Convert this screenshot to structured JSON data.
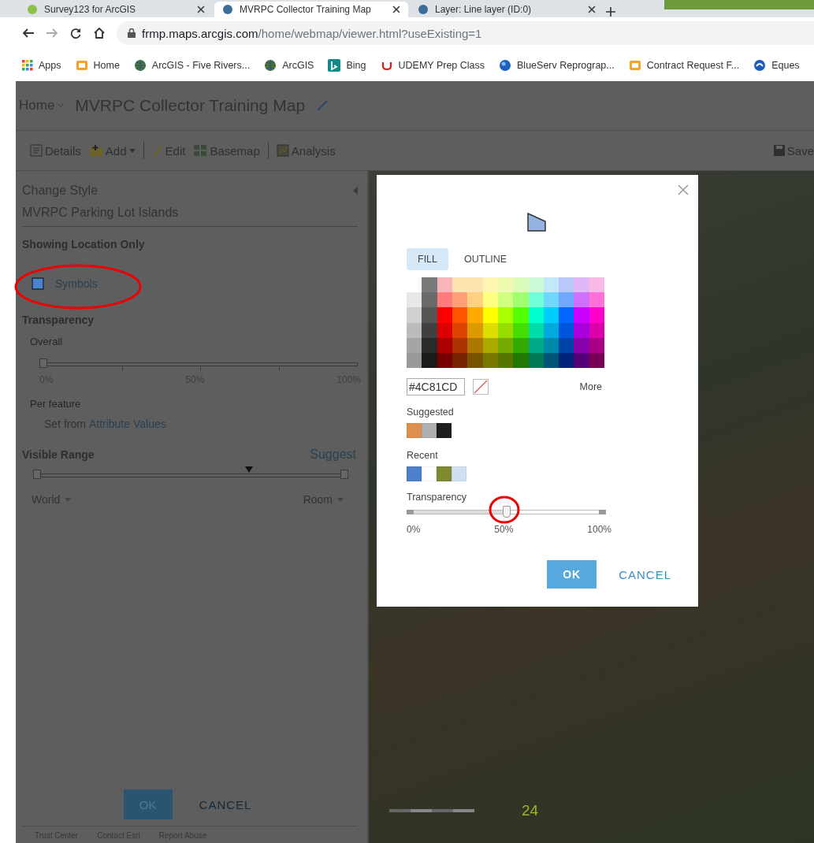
{
  "browser": {
    "tabs": [
      {
        "title": "Survey123 for ArcGIS",
        "selected": false
      },
      {
        "title": "MVRPC Collector Training Map",
        "selected": true
      },
      {
        "title": "Layer: Line layer (ID:0)",
        "selected": false
      }
    ],
    "address": {
      "host": "frmp.maps.arcgis.com",
      "path": "/home/webmap/viewer.html?useExisting=1"
    },
    "bookmarks": [
      {
        "label": "Apps",
        "kind": "apps"
      },
      {
        "label": "Home",
        "kind": "folder"
      },
      {
        "label": "ArcGIS - Five Rivers...",
        "kind": "globe"
      },
      {
        "label": "ArcGIS",
        "kind": "globe"
      },
      {
        "label": "Bing",
        "kind": "bing"
      },
      {
        "label": "UDEMY Prep Class",
        "kind": "udemy"
      },
      {
        "label": "BlueServ Reprograp...",
        "kind": "sphere"
      },
      {
        "label": "Contract Request F...",
        "kind": "folder"
      },
      {
        "label": "Eques",
        "kind": "edge"
      }
    ]
  },
  "header": {
    "home": "Home",
    "title": "MVRPC Collector Training Map"
  },
  "toolbar": {
    "items": [
      {
        "label": "Details",
        "kind": "details"
      },
      {
        "label": "Add",
        "kind": "add"
      },
      {
        "kind": "separator"
      },
      {
        "label": "Edit",
        "kind": "edit"
      },
      {
        "label": "Basemap",
        "kind": "basemap"
      },
      {
        "kind": "separator"
      },
      {
        "label": "Analysis",
        "kind": "analysis"
      }
    ],
    "save": "Save"
  },
  "panel": {
    "heading": "Change Style",
    "layer": "MVRPC Parking Lot Islands",
    "section": "Showing Location Only",
    "symbols": "Symbols",
    "transparency": {
      "title": "Transparency",
      "overall": "Overall",
      "level": 0,
      "ticks": [
        "0%",
        "50%",
        "100%"
      ],
      "per_feature": "Per feature",
      "set_from": "Set from",
      "link": "Attribute Values"
    },
    "visible_range": {
      "title": "Visible Range",
      "suggest": "Suggest",
      "level": 0.69,
      "min": "World",
      "max": "Room"
    },
    "ok": "OK",
    "cancel": "CANCEL",
    "footer": [
      "Trust Center",
      "Contact Esri",
      "Report Abuse"
    ]
  },
  "map": {
    "scale_label": "24"
  },
  "dialog": {
    "tabs": [
      {
        "label": "FILL",
        "selected": true
      },
      {
        "label": "OUTLINE",
        "selected": false
      }
    ],
    "palette": [
      [
        {
          "color": "#7a7a7a"
        },
        {
          "color": "#f8b4b8"
        },
        {
          "color": "#fde3b0"
        },
        {
          "color": "#fde3b0"
        },
        {
          "color": "#fdf5b0"
        },
        {
          "color": "#eefab0"
        },
        {
          "color": "#dcfab8"
        },
        {
          "color": "#c8fad8"
        },
        {
          "color": "#c0e8f8"
        },
        {
          "color": "#b8c8f8"
        },
        {
          "color": "#e0b8f8"
        },
        {
          "color": "#f8b8e8"
        }
      ],
      [
        {
          "color": "#e8e8e8"
        },
        {
          "color": "#6a6a6a"
        },
        {
          "color": "#ff7a7a"
        },
        {
          "color": "#ffa07a"
        },
        {
          "color": "#ffd080"
        },
        {
          "color": "#ffff80"
        },
        {
          "color": "#d0ff80"
        },
        {
          "color": "#a0ff70"
        },
        {
          "color": "#70ffd8"
        },
        {
          "color": "#70d8ff"
        },
        {
          "color": "#70a8ff"
        },
        {
          "color": "#d070ff"
        },
        {
          "color": "#ff70d8"
        }
      ],
      [
        {
          "color": "#d0d0d0"
        },
        {
          "color": "#555555"
        },
        {
          "color": "#ff0000"
        },
        {
          "color": "#ff5500"
        },
        {
          "color": "#ffaa00"
        },
        {
          "color": "#ffff00"
        },
        {
          "color": "#aaff00"
        },
        {
          "color": "#55ff00"
        },
        {
          "color": "#00ffcc"
        },
        {
          "color": "#00ccff"
        },
        {
          "color": "#0066ff"
        },
        {
          "color": "#cc00ff"
        },
        {
          "color": "#ff00cc"
        }
      ],
      [
        {
          "color": "#bbbbbb"
        },
        {
          "color": "#404040"
        },
        {
          "color": "#dd0000"
        },
        {
          "color": "#dd4400"
        },
        {
          "color": "#dd9900"
        },
        {
          "color": "#dddd00"
        },
        {
          "color": "#99dd00"
        },
        {
          "color": "#44dd00"
        },
        {
          "color": "#00ddaa"
        },
        {
          "color": "#00aadd"
        },
        {
          "color": "#0055dd"
        },
        {
          "color": "#aa00dd"
        },
        {
          "color": "#dd00aa"
        }
      ],
      [
        {
          "color": "#a5a5a5"
        },
        {
          "color": "#2a2a2a"
        },
        {
          "color": "#aa0000"
        },
        {
          "color": "#aa3300"
        },
        {
          "color": "#aa7700"
        },
        {
          "color": "#aaaa00"
        },
        {
          "color": "#77aa00"
        },
        {
          "color": "#33aa00"
        },
        {
          "color": "#00aa88"
        },
        {
          "color": "#0088aa"
        },
        {
          "color": "#0044aa"
        },
        {
          "color": "#8800aa"
        },
        {
          "color": "#aa0088"
        }
      ],
      [
        {
          "color": "#999999"
        },
        {
          "color": "#1a1a1a"
        },
        {
          "color": "#770000"
        },
        {
          "color": "#772200"
        },
        {
          "color": "#775500"
        },
        {
          "color": "#777700"
        },
        {
          "color": "#557700"
        },
        {
          "color": "#227700"
        },
        {
          "color": "#007755"
        },
        {
          "color": "#005577"
        },
        {
          "color": "#002277"
        },
        {
          "color": "#550077"
        },
        {
          "color": "#770055"
        }
      ]
    ],
    "hex": "#4C81CD",
    "more": "More",
    "suggested": {
      "title": "Suggested",
      "swatches": [
        {
          "color": "#e0904e"
        },
        {
          "color": "#b0b0b0"
        },
        {
          "color": "#1e1e1e"
        }
      ]
    },
    "recent": {
      "title": "Recent",
      "swatches": [
        {
          "color": "#4c81cd"
        },
        {
          "color": "#ffffff"
        },
        {
          "color": "#7e8a30"
        },
        {
          "color": "#cfe0f5"
        }
      ]
    },
    "transparency": {
      "title": "Transparency",
      "level": 0.5,
      "ticks": [
        "0%",
        "50%",
        "100%"
      ]
    },
    "ok": "OK",
    "cancel": "CANCEL"
  }
}
